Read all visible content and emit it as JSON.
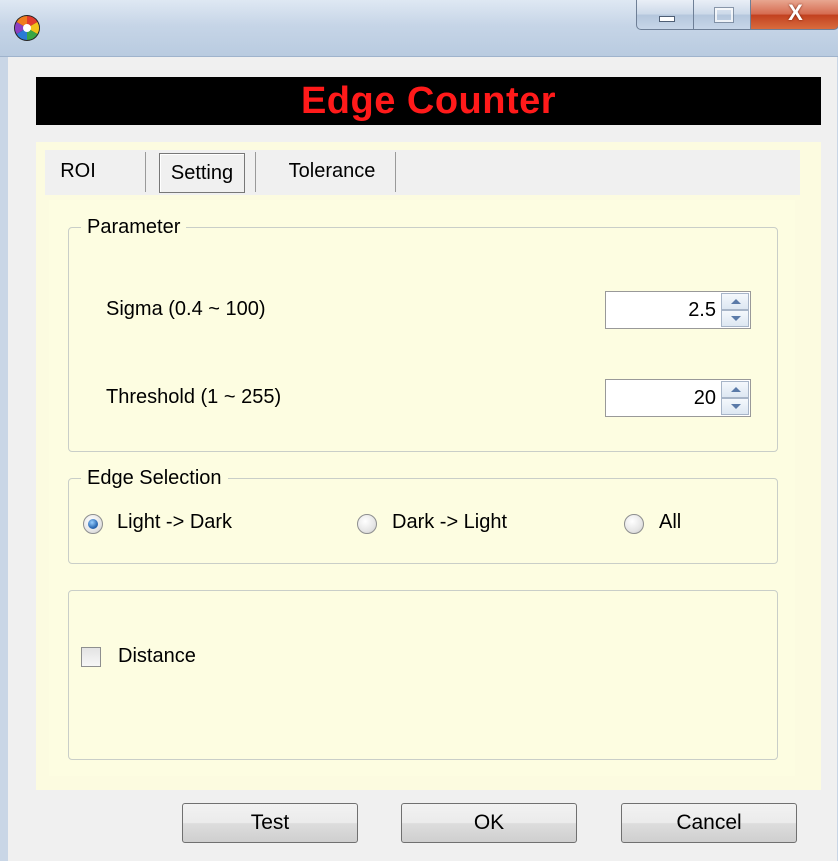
{
  "window": {
    "icon": "app-color-wheel-icon",
    "controls": {
      "minimize_icon": "minimize-icon",
      "maximize_icon": "maximize-icon",
      "close_icon": "close-icon",
      "close_glyph": "X"
    }
  },
  "banner": {
    "title": "Edge Counter",
    "text_color": "#ff1a1a",
    "background": "#000000"
  },
  "tabs": [
    {
      "label": "ROI",
      "selected": false
    },
    {
      "label": "Setting",
      "selected": true
    },
    {
      "label": "Tolerance",
      "selected": false
    }
  ],
  "parameter": {
    "title": "Parameter",
    "sigma": {
      "label": "Sigma (0.4 ~ 100)",
      "value": "2.5"
    },
    "threshold": {
      "label": "Threshold (1 ~ 255)",
      "value": "20"
    }
  },
  "edge_selection": {
    "title": "Edge Selection",
    "options": [
      {
        "label": "Light -> Dark",
        "checked": true
      },
      {
        "label": "Dark -> Light",
        "checked": false
      },
      {
        "label": "All",
        "checked": false
      }
    ]
  },
  "distance": {
    "label": "Distance",
    "checked": false
  },
  "buttons": {
    "test": "Test",
    "ok": "OK",
    "cancel": "Cancel"
  },
  "colors": {
    "page_background": "#fdfde1",
    "window_background": "#f0f0f0"
  }
}
